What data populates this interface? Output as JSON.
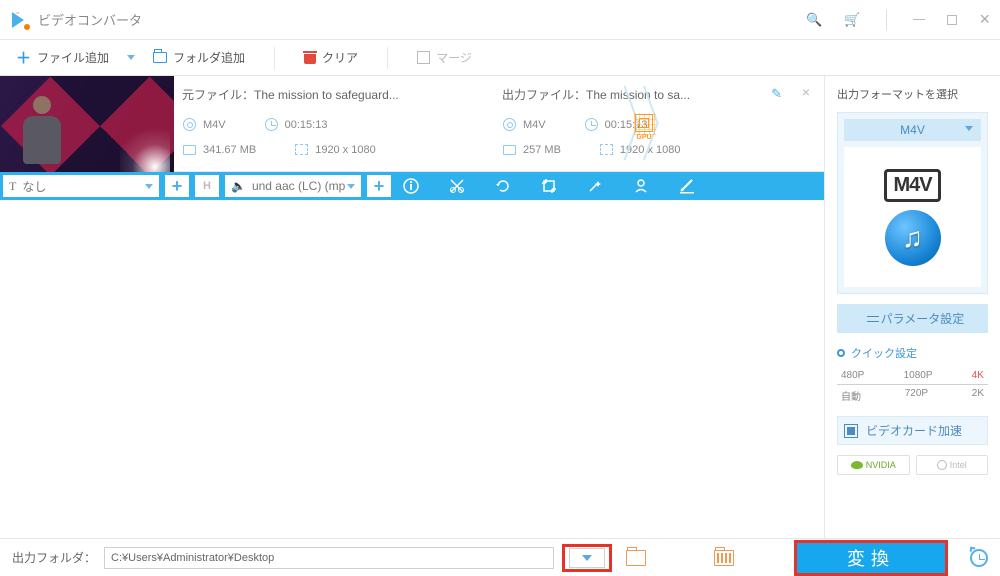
{
  "titlebar": {
    "title": "ビデオコンバータ"
  },
  "toolbar": {
    "add_file": "ファイル追加",
    "add_folder": "フォルダ追加",
    "clear": "クリア",
    "merge": "マージ"
  },
  "file": {
    "source_label": "元ファイル：",
    "source_name": "The mission to safeguard...",
    "output_label": "出力ファイル：",
    "output_name": "The mission to sa...",
    "src": {
      "format": "M4V",
      "duration": "00:15:13",
      "size": "341.67 MB",
      "resolution": "1920 x 1080"
    },
    "out": {
      "format": "M4V",
      "duration": "00:15:13",
      "size": "257 MB",
      "resolution": "1920 x 1080"
    },
    "gpu_label": "GPU",
    "subtitle": "なし",
    "subtitle_prefix": "T",
    "h_label": "H",
    "audio": "und aac (LC) (mp"
  },
  "right": {
    "header": "出力フォーマットを選択",
    "format": "M4V",
    "badge": "M4V",
    "params": "パラメータ設定",
    "quick": "クイック設定",
    "presets_top": [
      "480P",
      "1080P",
      "4K"
    ],
    "presets_bottom": [
      "自動",
      "720P",
      "2K"
    ],
    "gpu_accel": "ビデオカード加速",
    "nvidia": "NVIDIA",
    "intel": "Intel"
  },
  "bottom": {
    "out_folder_label": "出力フォルダ：",
    "out_folder_path": "C:¥Users¥Administrator¥Desktop",
    "convert": "変換"
  }
}
